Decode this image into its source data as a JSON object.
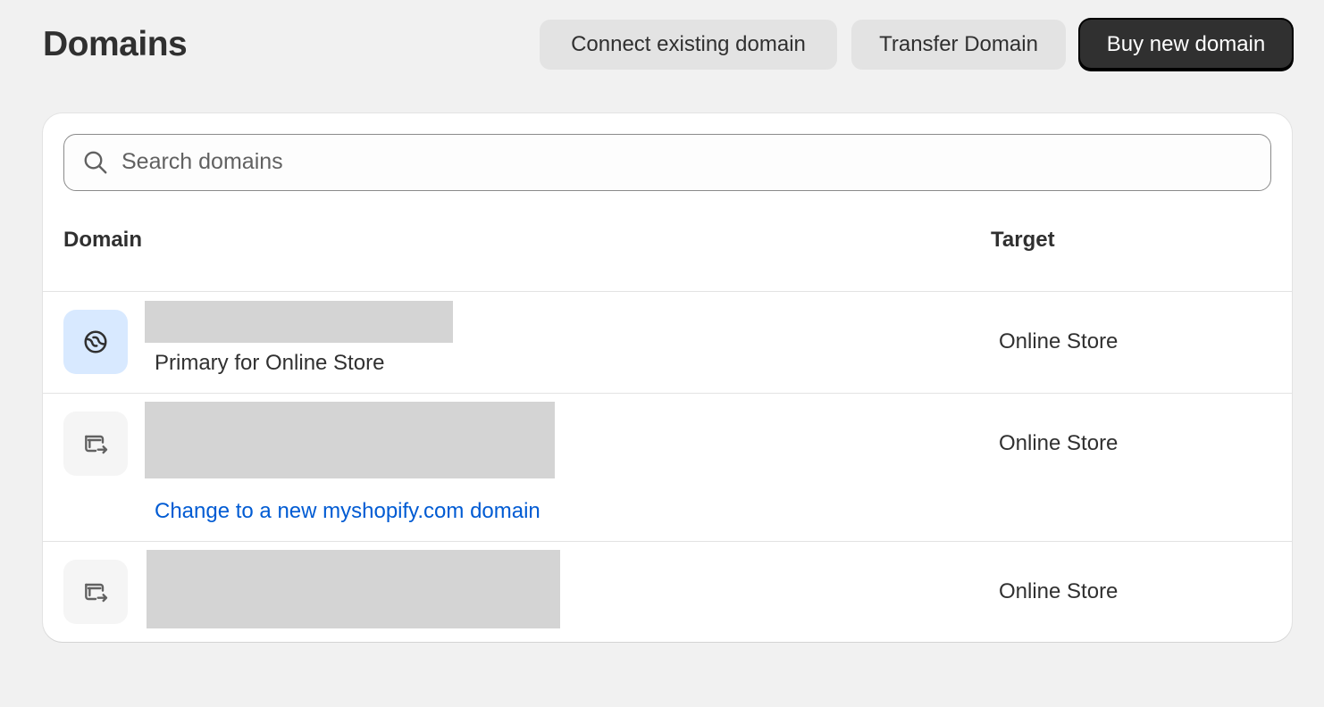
{
  "header": {
    "title": "Domains",
    "connect_label": "Connect existing domain",
    "transfer_label": "Transfer Domain",
    "buy_label": "Buy new domain"
  },
  "search": {
    "placeholder": "Search domains",
    "value": ""
  },
  "table": {
    "columns": [
      "Domain",
      "Target"
    ],
    "rows": [
      {
        "icon": "globe-icon",
        "subtitle": "Primary for Online Store",
        "target": "Online Store"
      },
      {
        "icon": "redirect-icon",
        "link": "Change to a new myshopify.com domain",
        "target": "Online Store"
      },
      {
        "icon": "redirect-icon",
        "target": "Online Store"
      }
    ]
  },
  "colors": {
    "primary_button": "#303030",
    "link": "#005bd3",
    "globe_badge": "#d8e9ff"
  }
}
